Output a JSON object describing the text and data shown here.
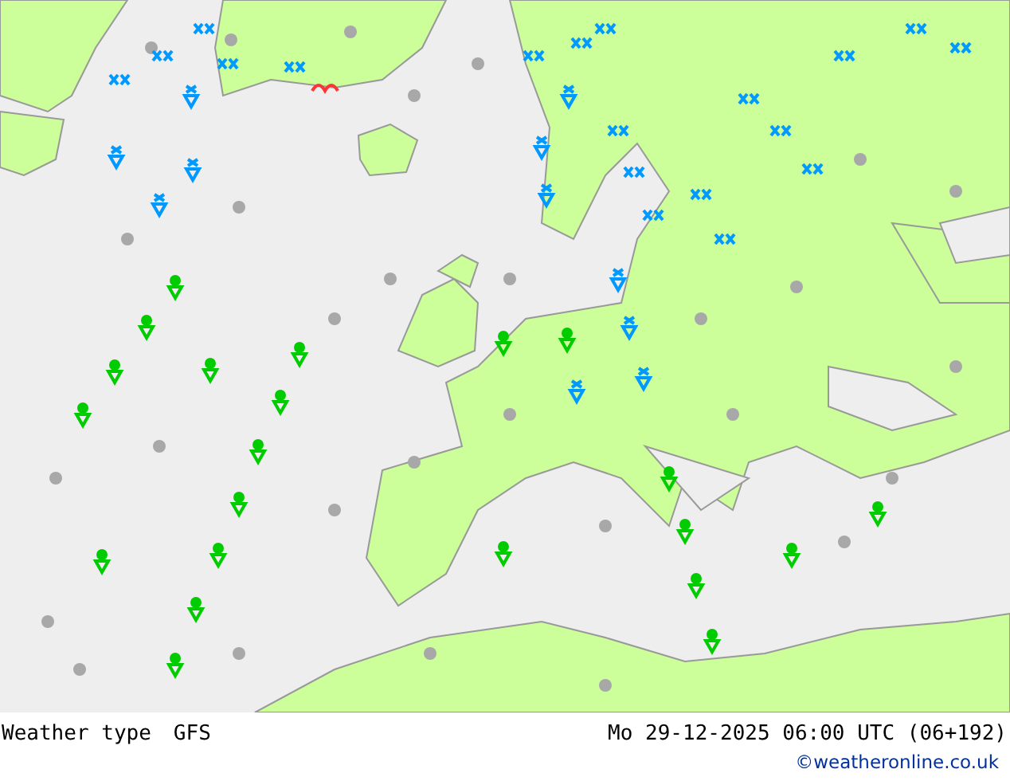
{
  "map": {
    "title": "Weather type",
    "model": "GFS",
    "valid_time": "Mo 29-12-2025 06:00 UTC (06+192)",
    "credit": "©weatheronline.co.uk"
  }
}
